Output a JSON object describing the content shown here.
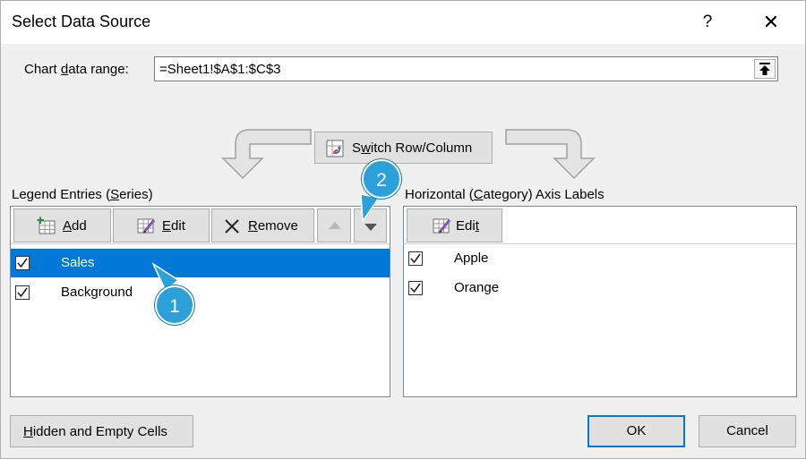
{
  "dialog": {
    "title": "Select Data Source",
    "help_glyph": "?",
    "close_glyph": "✕"
  },
  "range": {
    "label_pre": "Chart ",
    "label_u": "d",
    "label_post": "ata range:",
    "value": "=Sheet1!$A$1:$C$3"
  },
  "switch": {
    "label_u": "w",
    "label_pre": "S",
    "label_post": "itch Row/Column"
  },
  "legend": {
    "label_pre": "Legend Entries (",
    "label_u": "S",
    "label_post": "eries)",
    "add_u": "A",
    "add_post": "dd",
    "edit_u": "E",
    "edit_post": "dit",
    "remove_u": "R",
    "remove_post": "emove",
    "items": [
      {
        "label": "Sales",
        "checked": true,
        "selected": true
      },
      {
        "label": "Background",
        "checked": true,
        "selected": false
      }
    ]
  },
  "axis": {
    "label_pre": "Horizontal (",
    "label_u": "C",
    "label_post": "ategory) Axis Labels",
    "edit_pre": "Edi",
    "edit_u": "t",
    "items": [
      {
        "label": "Apple",
        "checked": true
      },
      {
        "label": "Orange",
        "checked": true
      }
    ]
  },
  "footer": {
    "hidden_u": "H",
    "hidden_post": "idden and Empty Cells",
    "ok": "OK",
    "cancel": "Cancel"
  },
  "callouts": [
    "1",
    "2"
  ],
  "colors": {
    "selection": "#0078d7",
    "callout": "#2ca0d8"
  }
}
